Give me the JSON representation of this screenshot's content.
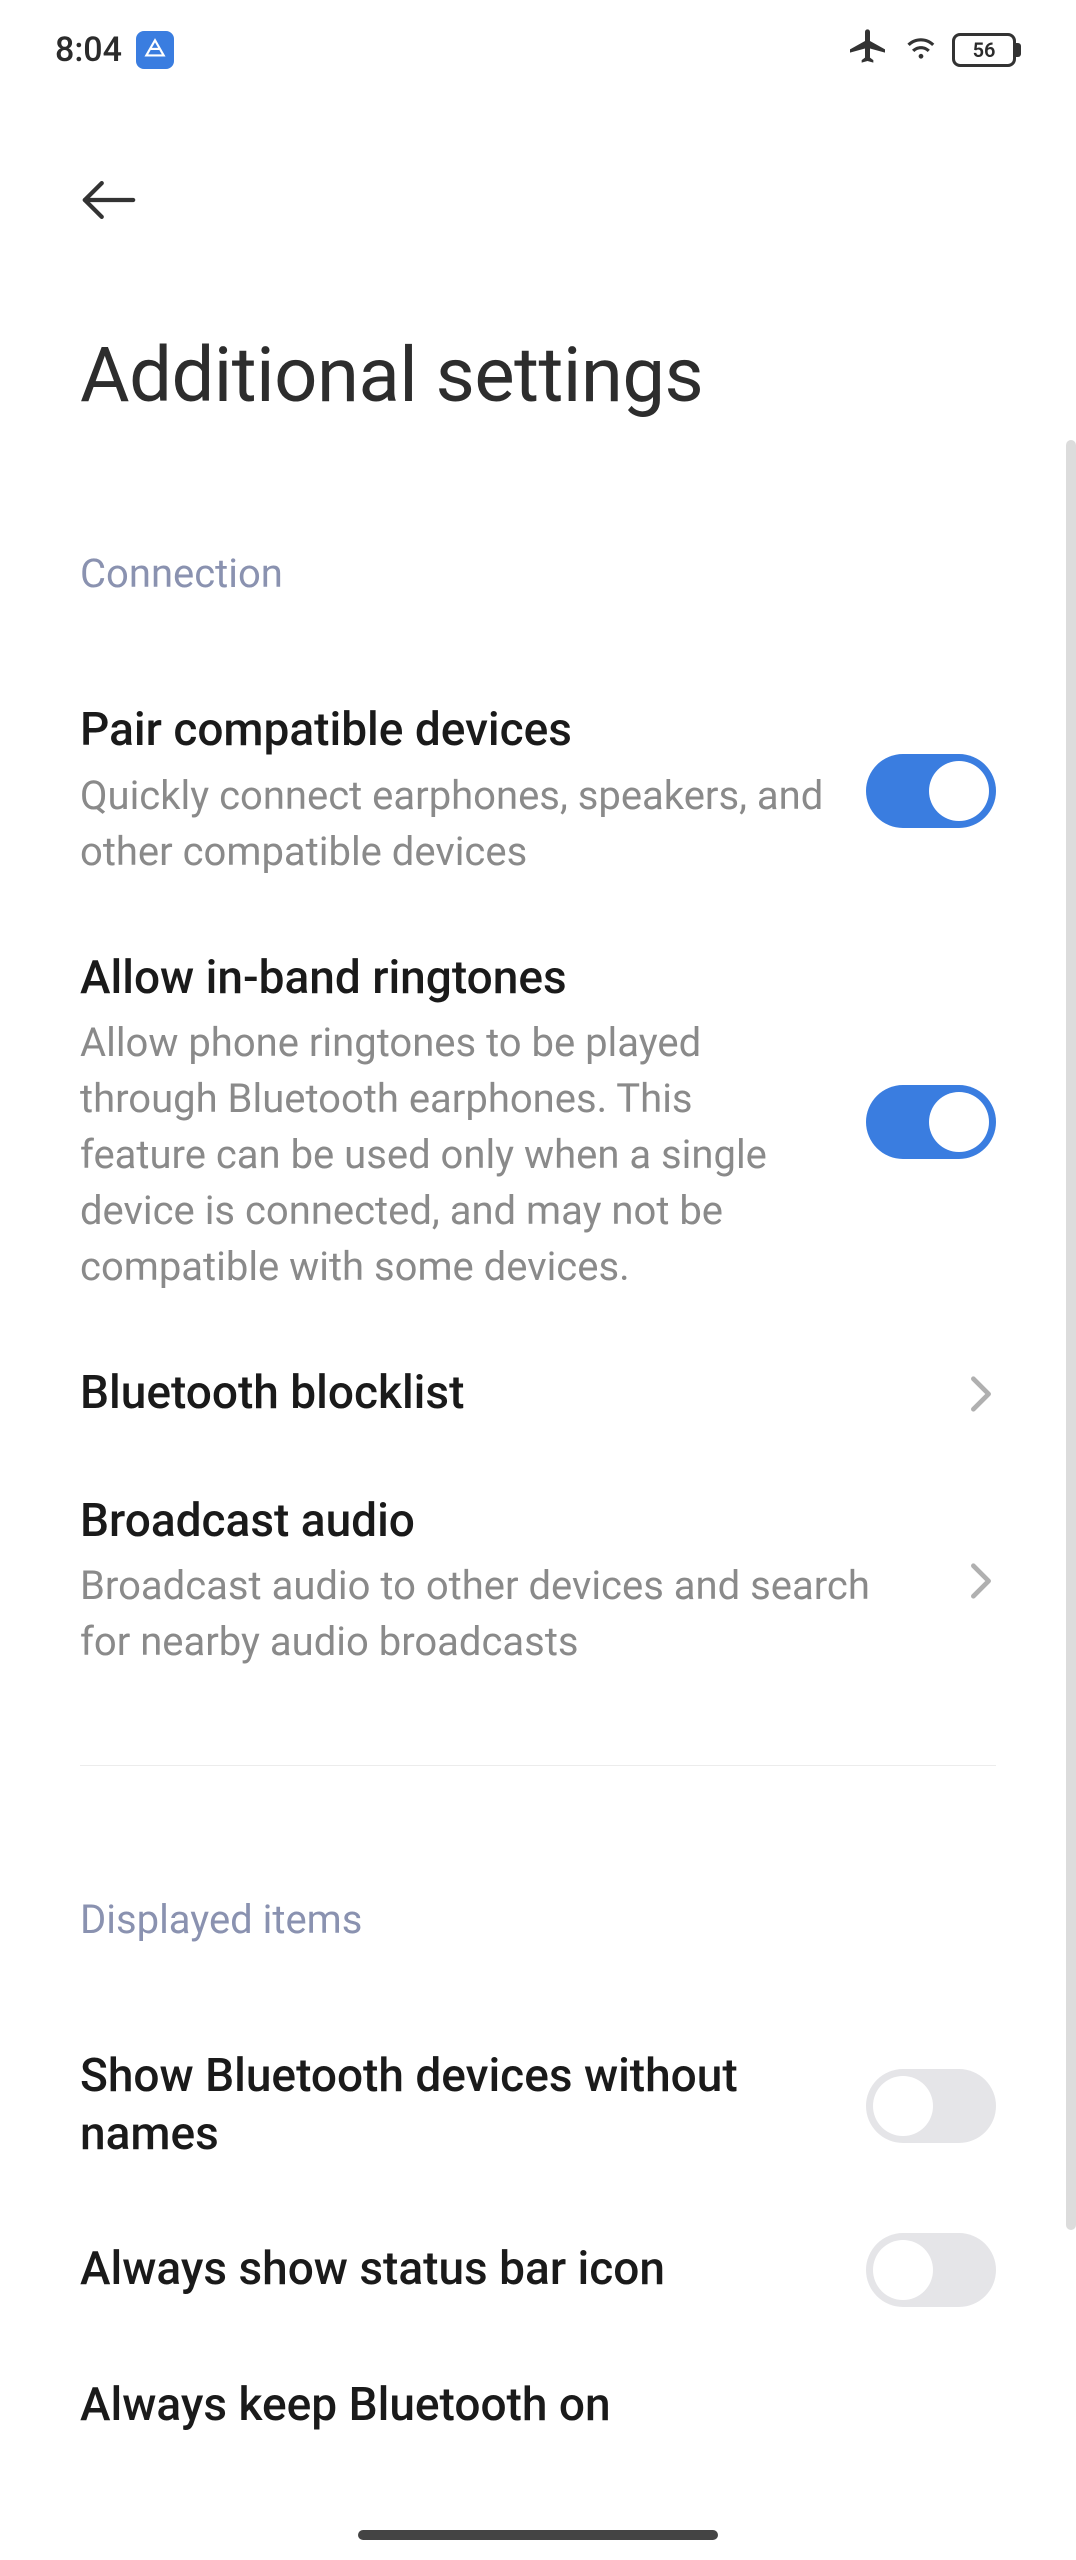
{
  "status": {
    "time": "8:04",
    "battery": "56"
  },
  "page": {
    "title": "Additional settings"
  },
  "sections": {
    "connection": {
      "header": "Connection"
    },
    "displayed": {
      "header": "Displayed items"
    }
  },
  "settings": {
    "pair": {
      "title": "Pair compatible devices",
      "desc": "Quickly connect earphones, speakers, and other compatible devices",
      "on": true
    },
    "inband": {
      "title": "Allow in-band ringtones",
      "desc": "Allow phone ringtones to be played through Bluetooth earphones. This feature can be used only when a single device is connected, and may not be compatible with some devices.",
      "on": true
    },
    "blocklist": {
      "title": "Bluetooth blocklist"
    },
    "broadcast": {
      "title": "Broadcast audio",
      "desc": "Broadcast audio to other devices and search for nearby audio broadcasts"
    },
    "show_unnamed": {
      "title": "Show Bluetooth devices without names",
      "on": false
    },
    "status_icon": {
      "title": "Always show status bar icon",
      "on": false
    },
    "keep_on": {
      "title": "Always keep Bluetooth on"
    }
  }
}
